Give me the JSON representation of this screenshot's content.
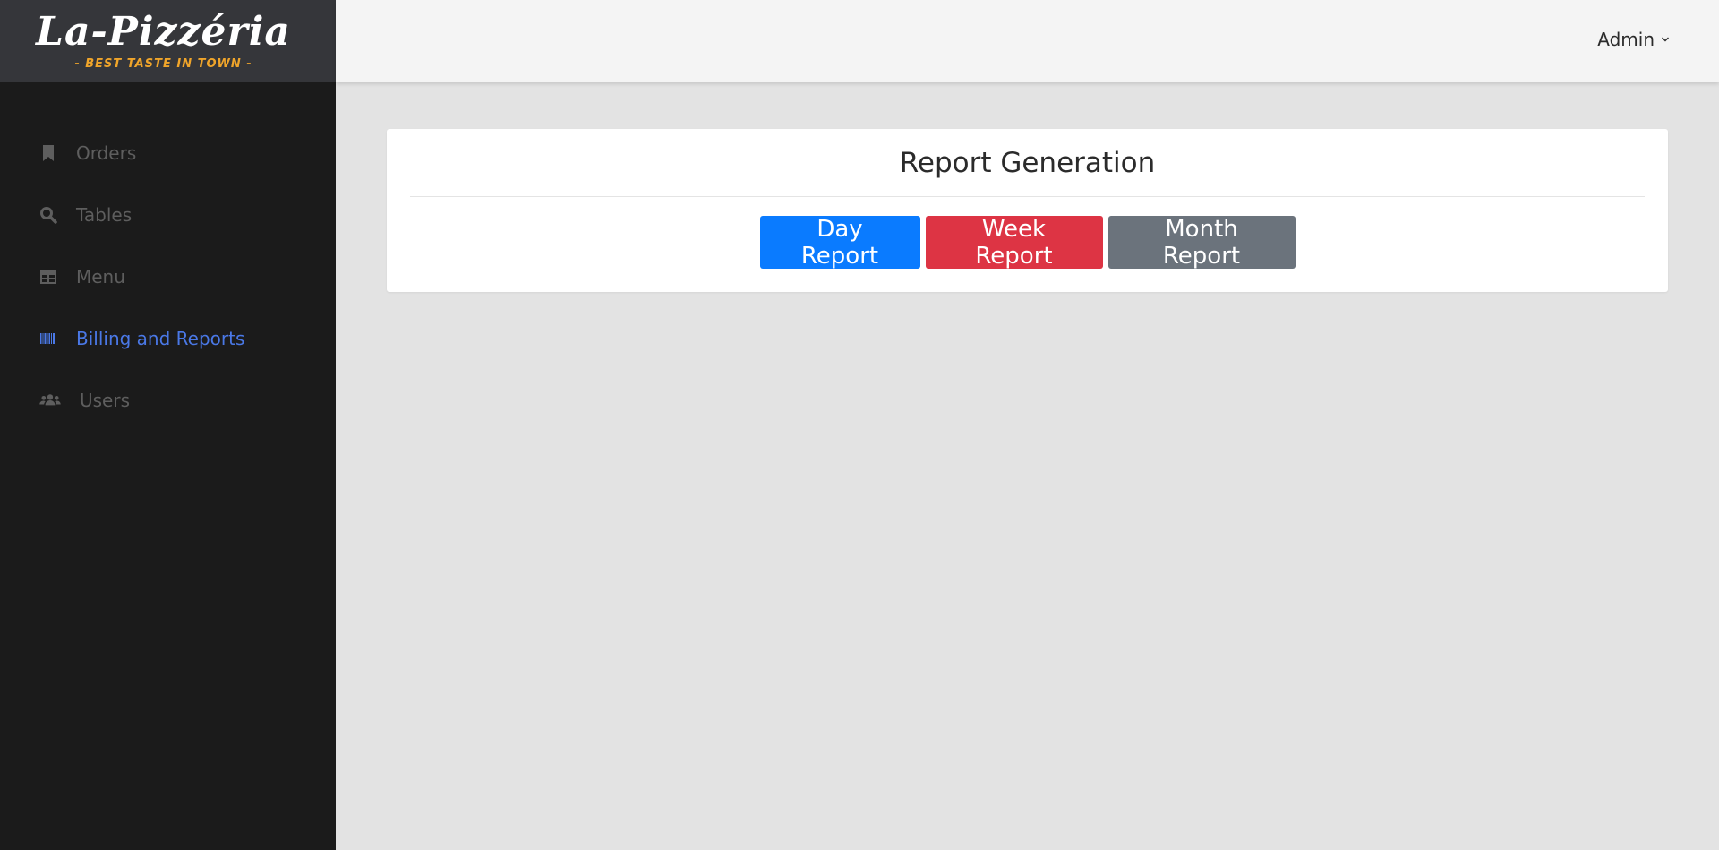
{
  "brand": {
    "name": "La-Pizzéria",
    "tagline": "- BEST TASTE IN TOWN -"
  },
  "sidebar": {
    "items": [
      {
        "label": "Orders",
        "icon": "bookmark-icon",
        "active": false
      },
      {
        "label": "Tables",
        "icon": "search-icon",
        "active": false
      },
      {
        "label": "Menu",
        "icon": "table-icon",
        "active": false
      },
      {
        "label": "Billing and Reports",
        "icon": "barcode-icon",
        "active": true
      },
      {
        "label": "Users",
        "icon": "users-icon",
        "active": false
      }
    ]
  },
  "header": {
    "user_menu_label": "Admin"
  },
  "report": {
    "title": "Report Generation",
    "buttons": {
      "day": "Day Report",
      "week": "Week Report",
      "month": "Month Report"
    }
  },
  "colors": {
    "sidebar_bg": "#1b1b1b",
    "brand_bg": "#35363a",
    "active_nav": "#4a78e6",
    "day_button": "#0a7bff",
    "week_button": "#dd3444",
    "month_button": "#6b737c",
    "tagline": "#f0a52a"
  }
}
